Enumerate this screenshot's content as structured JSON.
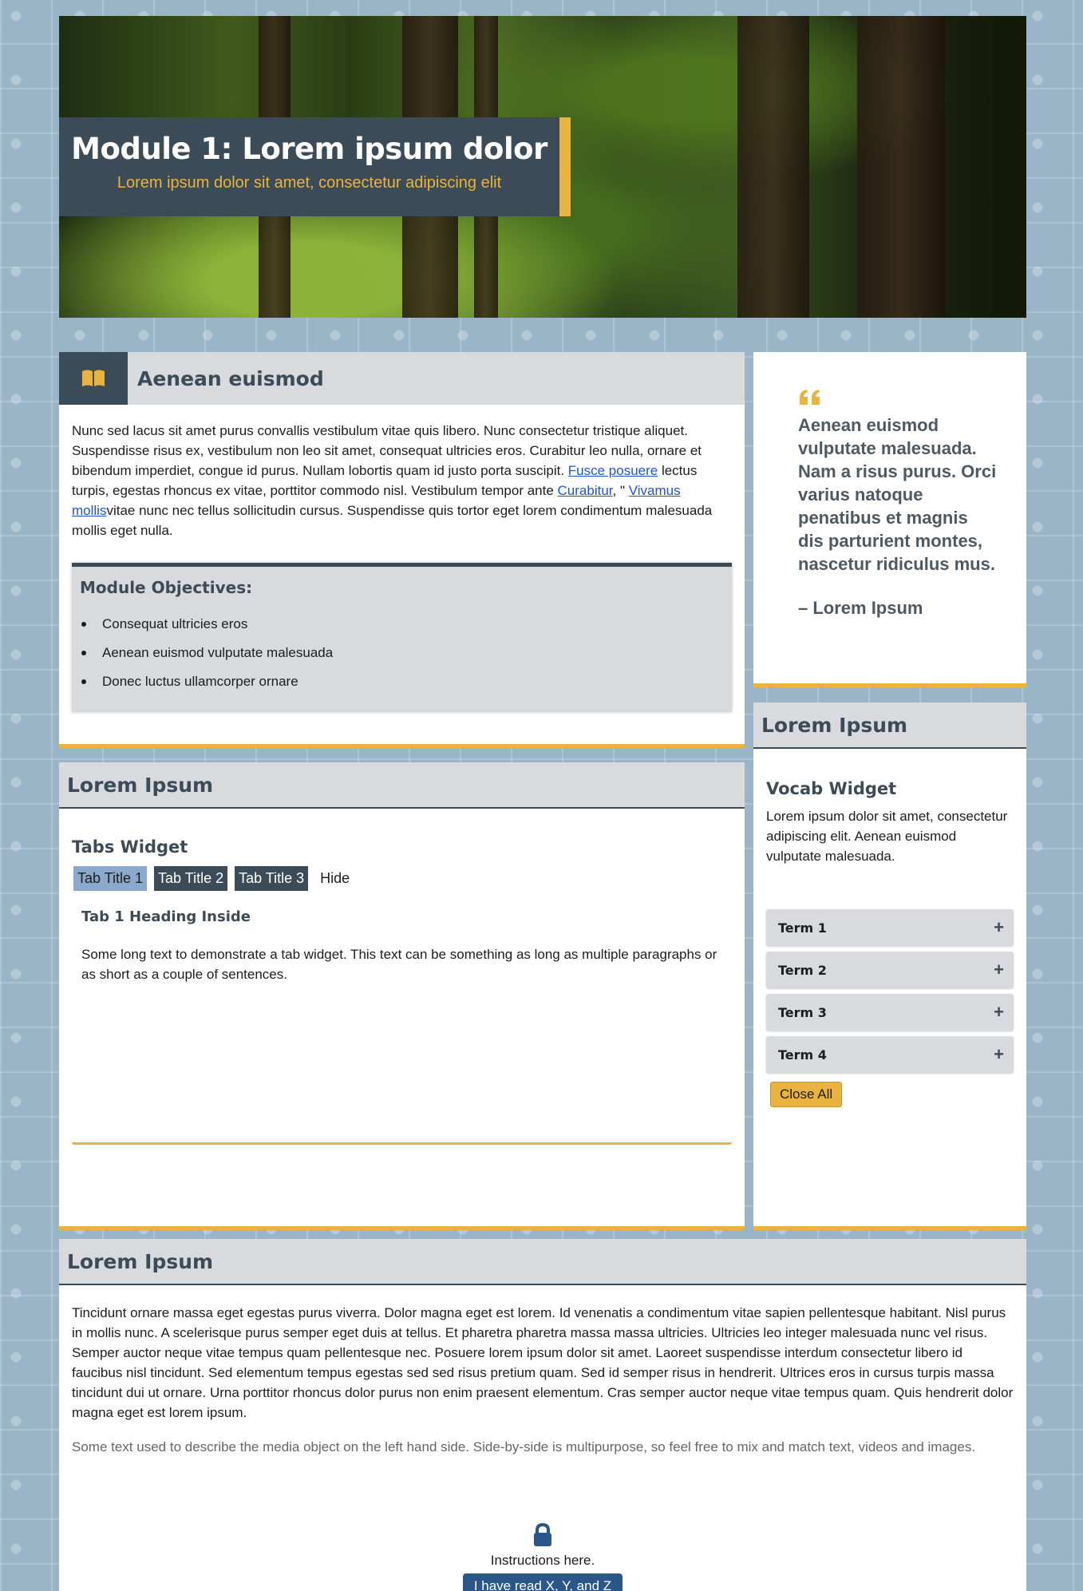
{
  "hero": {
    "title": "Module 1: Lorem ipsum dolor",
    "subtitle": "Lorem ipsum dolor sit amet, consectetur adipiscing elit"
  },
  "aenean": {
    "heading": "Aenean euismod",
    "text_before_link1": "Nunc sed lacus sit amet purus convallis vestibulum vitae quis libero. Nunc consectetur tristique aliquet. Suspendisse risus ex, vestibulum non leo sit amet, consequat ultricies eros. Curabitur leo nulla, ornare et bibendum imperdiet, congue id purus. Nullam lobortis quam id justo porta suscipit. ",
    "link1": "Fusce posuere",
    "text_after_link1": " lectus turpis, egestas rhoncus ex vitae, porttitor commodo nisl. Vestibulum tempor ante ",
    "link2": "Curabitur",
    "text_between": ", \" ",
    "link3": "Vivamus mollis",
    "text_end": "vitae nunc nec tellus sollicitudin cursus. Suspendisse quis tortor eget lorem condimentum malesuada mollis eget nulla.",
    "objectives_title": "Module Objectives:",
    "objectives": [
      "Consequat ultricies eros",
      "Aenean euismod vulputate malesuada",
      "Donec luctus ullamcorper ornare"
    ]
  },
  "quote": {
    "text": "Aenean euismod vulputate malesuada. Nam a risus purus. Orci varius natoque penatibus et magnis dis parturient montes, nascetur ridiculus mus.",
    "author": "– Lorem Ipsum"
  },
  "tabs_panel": {
    "heading": "Lorem Ipsum",
    "widget_title": "Tabs Widget",
    "tabs": [
      "Tab Title 1",
      "Tab Title 2",
      "Tab Title 3"
    ],
    "hide_label": "Hide",
    "content_heading": "Tab 1 Heading Inside",
    "content_text": "Some long text to demonstrate a tab widget. This text can be something as long as multiple paragraphs or as short as a couple of sentences."
  },
  "vocab_panel": {
    "heading": "Lorem Ipsum",
    "widget_title": "Vocab Widget",
    "description": "Lorem ipsum dolor sit amet, consectetur adipiscing elit. Aenean euismod vulputate malesuada.",
    "terms": [
      "Term 1",
      "Term 2",
      "Term 3",
      "Term 4"
    ],
    "plus_symbol": "+",
    "close_all": "Close All"
  },
  "bottom_panel": {
    "heading": "Lorem Ipsum",
    "text": "Tincidunt ornare massa eget egestas purus viverra. Dolor magna eget est lorem. Id venenatis a condimentum vitae sapien pellentesque habitant. Nisl purus in mollis nunc. A scelerisque purus semper eget duis at tellus. Et pharetra pharetra massa massa ultricies. Ultricies leo integer malesuada nunc vel risus. Semper auctor neque vitae tempus quam pellentesque nec. Posuere lorem ipsum dolor sit amet. Laoreet suspendisse interdum consectetur libero id faucibus nisl tincidunt. Sed elementum tempus egestas sed sed risus pretium quam. Sed id semper risus in hendrerit. Ultrices eros in cursus turpis massa tincidunt dui ut ornare. Urna porttitor rhoncus dolor purus non enim praesent elementum. Cras semper auctor neque vitae tempus quam. Quis hendrerit dolor magna eget est lorem ipsum.",
    "media_caption": "Some text used to describe the media object on the left hand side. Side-by-side is multipurpose, so feel free to mix and match text, videos and images.",
    "instructions": "Instructions here.",
    "read_button": "I have read X, Y, and Z"
  },
  "colors": {
    "accent": "#eab33f",
    "slate": "#3c4b58",
    "header_gray": "#d8dadd",
    "tab_active": "#8aa9cc",
    "button_blue": "#2a5689",
    "background": "#9bb5c8"
  },
  "icons": [
    "open-book-icon",
    "quote-icon",
    "plus-icon",
    "lock-icon"
  ]
}
